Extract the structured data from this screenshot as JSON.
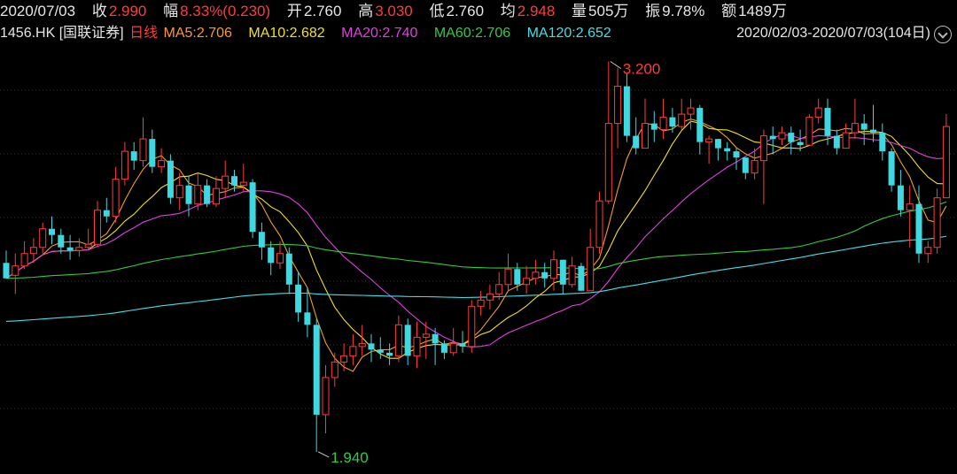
{
  "header": {
    "date": "2020/07/03",
    "close_label": "收",
    "close_value": "2.990",
    "change_label": "幅",
    "change_value": "8.33%(0.230)",
    "open_label": "开",
    "open_value": "2.760",
    "high_label": "高",
    "high_value": "3.030",
    "low_label": "低",
    "low_value": "2.760",
    "avg_label": "均",
    "avg_value": "2.948",
    "volume_label": "量",
    "volume_value": "505万",
    "amplitude_label": "振",
    "amplitude_value": "9.78%",
    "turnover_label": "额",
    "turnover_value": "1489万"
  },
  "legend": {
    "ticker": "1456.HK [国联证券]",
    "period": "日线",
    "ma5": "MA5:2.706",
    "ma10": "MA10:2.682",
    "ma20": "MA20:2.740",
    "ma60": "MA60:2.706",
    "ma120": "MA120:2.652",
    "range": "2020/02/03-2020/07/03(104日)"
  },
  "colors": {
    "up": "#ff3c3c",
    "down": "#40d8e0",
    "flat": "#e6e6e6",
    "ma5": "#f0a020",
    "ma10": "#f0e020",
    "ma20": "#e040e0",
    "ma60": "#2ecc40",
    "ma120": "#40e0e8",
    "grid": "#333333"
  },
  "chart_data": {
    "type": "candlestick",
    "title": "1456.HK [国联证券] 日线",
    "period_start": "2020/02/03",
    "period_end": "2020/07/03",
    "trading_days": 104,
    "ylim": [
      1.88,
      3.25
    ],
    "grid": true,
    "annotations": [
      {
        "text": "3.200",
        "index": 66,
        "value": 3.2,
        "kind": "high",
        "color": "#ff3c3c"
      },
      {
        "text": "1.940",
        "index": 34,
        "value": 1.94,
        "kind": "low",
        "color": "#2ecc40"
      }
    ],
    "candles": [
      [
        2.55,
        2.5,
        2.59,
        2.5
      ],
      [
        2.51,
        2.54,
        2.58,
        2.45
      ],
      [
        2.54,
        2.58,
        2.62,
        2.53
      ],
      [
        2.58,
        2.6,
        2.63,
        2.55
      ],
      [
        2.6,
        2.66,
        2.68,
        2.58
      ],
      [
        2.66,
        2.64,
        2.7,
        2.61
      ],
      [
        2.64,
        2.6,
        2.66,
        2.58
      ],
      [
        2.6,
        2.59,
        2.64,
        2.56
      ],
      [
        2.59,
        2.6,
        2.63,
        2.57
      ],
      [
        2.6,
        2.61,
        2.66,
        2.59
      ],
      [
        2.61,
        2.72,
        2.75,
        2.6
      ],
      [
        2.72,
        2.7,
        2.76,
        2.68
      ],
      [
        2.7,
        2.82,
        2.86,
        2.68
      ],
      [
        2.82,
        2.91,
        2.94,
        2.8
      ],
      [
        2.91,
        2.88,
        2.94,
        2.85
      ],
      [
        2.88,
        2.95,
        3.02,
        2.86
      ],
      [
        2.95,
        2.86,
        2.98,
        2.84
      ],
      [
        2.86,
        2.88,
        2.92,
        2.84
      ],
      [
        2.88,
        2.76,
        2.9,
        2.74
      ],
      [
        2.76,
        2.8,
        2.84,
        2.72
      ],
      [
        2.8,
        2.74,
        2.83,
        2.7
      ],
      [
        2.74,
        2.8,
        2.84,
        2.72
      ],
      [
        2.8,
        2.74,
        2.82,
        2.73
      ],
      [
        2.74,
        2.79,
        2.83,
        2.73
      ],
      [
        2.79,
        2.83,
        2.88,
        2.76
      ],
      [
        2.83,
        2.8,
        2.85,
        2.78
      ],
      [
        2.8,
        2.81,
        2.87,
        2.78
      ],
      [
        2.81,
        2.65,
        2.82,
        2.63
      ],
      [
        2.65,
        2.6,
        2.68,
        2.56
      ],
      [
        2.6,
        2.55,
        2.62,
        2.51
      ],
      [
        2.55,
        2.58,
        2.62,
        2.53
      ],
      [
        2.58,
        2.48,
        2.6,
        2.45
      ],
      [
        2.48,
        2.39,
        2.52,
        2.36
      ],
      [
        2.39,
        2.35,
        2.47,
        2.31
      ],
      [
        2.35,
        2.06,
        2.37,
        1.94
      ],
      [
        2.06,
        2.18,
        2.22,
        2.0
      ],
      [
        2.18,
        2.23,
        2.26,
        2.15
      ],
      [
        2.23,
        2.25,
        2.29,
        2.2
      ],
      [
        2.25,
        2.28,
        2.32,
        2.22
      ],
      [
        2.28,
        2.29,
        2.35,
        2.25
      ],
      [
        2.29,
        2.27,
        2.32,
        2.23
      ],
      [
        2.27,
        2.26,
        2.31,
        2.24
      ],
      [
        2.26,
        2.25,
        2.29,
        2.22
      ],
      [
        2.25,
        2.35,
        2.38,
        2.23
      ],
      [
        2.35,
        2.25,
        2.37,
        2.22
      ],
      [
        2.25,
        2.31,
        2.36,
        2.21
      ],
      [
        2.31,
        2.32,
        2.36,
        2.24
      ],
      [
        2.32,
        2.29,
        2.34,
        2.22
      ],
      [
        2.29,
        2.26,
        2.3,
        2.24
      ],
      [
        2.26,
        2.29,
        2.34,
        2.25
      ],
      [
        2.29,
        2.28,
        2.33,
        2.26
      ],
      [
        2.28,
        2.41,
        2.43,
        2.26
      ],
      [
        2.41,
        2.43,
        2.46,
        2.38
      ],
      [
        2.43,
        2.45,
        2.48,
        2.4
      ],
      [
        2.45,
        2.48,
        2.52,
        2.43
      ],
      [
        2.48,
        2.53,
        2.58,
        2.46
      ],
      [
        2.53,
        2.48,
        2.55,
        2.46
      ],
      [
        2.48,
        2.5,
        2.54,
        2.45
      ],
      [
        2.5,
        2.52,
        2.56,
        2.48
      ],
      [
        2.52,
        2.5,
        2.55,
        2.47
      ],
      [
        2.5,
        2.56,
        2.59,
        2.46
      ],
      [
        2.56,
        2.48,
        2.56,
        2.45
      ],
      [
        2.48,
        2.54,
        2.57,
        2.47
      ],
      [
        2.54,
        2.46,
        2.55,
        2.46
      ],
      [
        2.46,
        2.6,
        2.66,
        2.46
      ],
      [
        2.6,
        2.75,
        2.78,
        2.58
      ],
      [
        2.75,
        3.0,
        3.2,
        2.74
      ],
      [
        3.0,
        3.12,
        3.18,
        2.92
      ],
      [
        3.12,
        2.96,
        3.16,
        2.94
      ],
      [
        2.96,
        2.92,
        3.02,
        2.9
      ],
      [
        2.92,
        3.0,
        3.08,
        2.92
      ],
      [
        3.0,
        2.98,
        3.04,
        2.94
      ],
      [
        2.98,
        3.02,
        3.08,
        2.95
      ],
      [
        3.02,
        2.99,
        3.05,
        2.97
      ],
      [
        2.99,
        3.03,
        3.08,
        2.98
      ],
      [
        3.03,
        3.05,
        3.08,
        2.98
      ],
      [
        3.05,
        2.94,
        3.06,
        2.9
      ],
      [
        2.94,
        2.95,
        2.96,
        2.87
      ],
      [
        2.95,
        2.92,
        2.95,
        2.88
      ],
      [
        2.92,
        2.91,
        2.94,
        2.88
      ],
      [
        2.91,
        2.89,
        2.92,
        2.85
      ],
      [
        2.89,
        2.84,
        2.89,
        2.82
      ],
      [
        2.84,
        2.88,
        2.92,
        2.82
      ],
      [
        2.88,
        2.96,
        2.98,
        2.74
      ],
      [
        2.96,
        2.95,
        2.99,
        2.9
      ],
      [
        2.95,
        2.97,
        2.99,
        2.93
      ],
      [
        2.97,
        2.94,
        2.99,
        2.9
      ],
      [
        2.94,
        2.93,
        2.98,
        2.91
      ],
      [
        2.93,
        3.02,
        3.03,
        2.95
      ],
      [
        3.02,
        3.05,
        3.08,
        3.0
      ],
      [
        3.05,
        2.96,
        3.08,
        2.93
      ],
      [
        2.96,
        2.92,
        2.98,
        2.9
      ],
      [
        2.92,
        2.97,
        3.0,
        2.92
      ],
      [
        2.97,
        3.0,
        3.08,
        2.95
      ],
      [
        3.0,
        2.98,
        3.03,
        2.93
      ],
      [
        2.98,
        2.97,
        3.06,
        2.94
      ],
      [
        2.97,
        2.91,
        3.0,
        2.88
      ],
      [
        2.91,
        2.8,
        2.92,
        2.78
      ],
      [
        2.8,
        2.72,
        2.85,
        2.7
      ],
      [
        2.72,
        2.74,
        2.8,
        2.6
      ],
      [
        2.74,
        2.58,
        2.8,
        2.55
      ],
      [
        2.58,
        2.6,
        2.62,
        2.55
      ],
      [
        2.6,
        2.76,
        2.79,
        2.58
      ],
      [
        2.76,
        2.99,
        3.03,
        2.76
      ]
    ]
  }
}
